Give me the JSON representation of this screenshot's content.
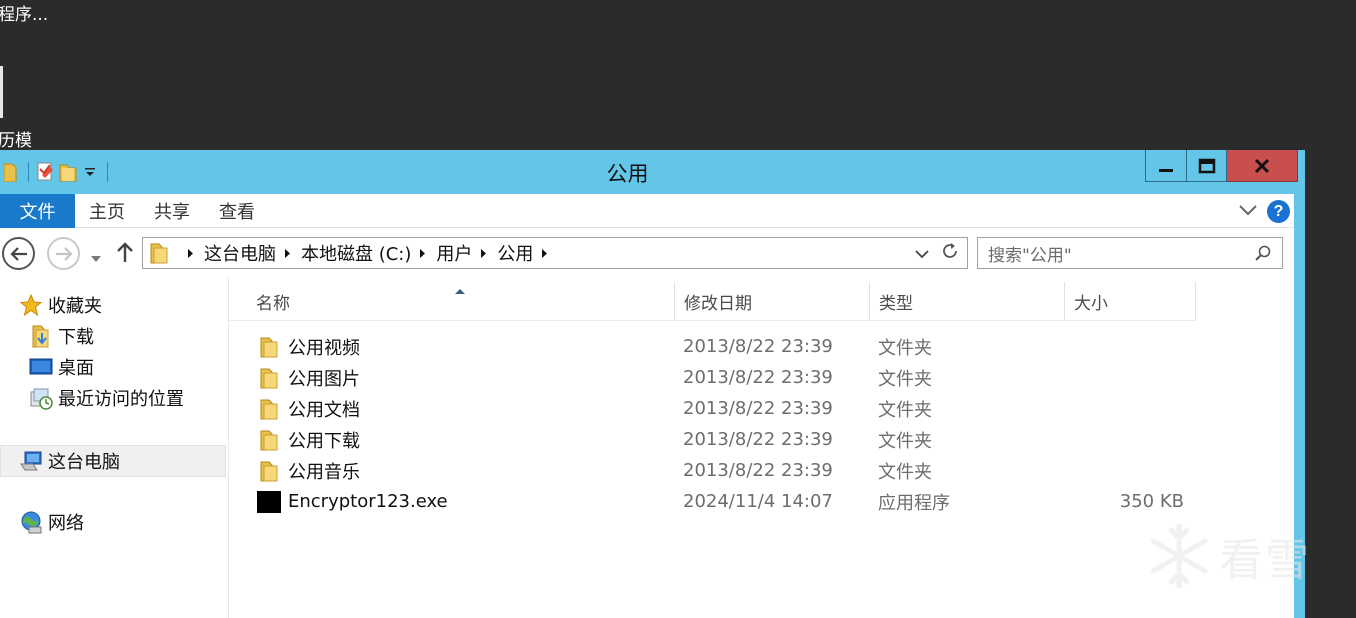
{
  "desktop": {
    "fragment_top": "程序...",
    "fragment_mid": "历模"
  },
  "window": {
    "title": "公用",
    "controls": {
      "minimize": "minimize",
      "maximize": "maximize",
      "close": "close"
    }
  },
  "ribbon": {
    "file_tab": "文件",
    "tabs": [
      "主页",
      "共享",
      "查看"
    ]
  },
  "address": {
    "crumbs": [
      "这台电脑",
      "本地磁盘 (C:)",
      "用户",
      "公用"
    ]
  },
  "search": {
    "placeholder": "搜索\"公用\""
  },
  "sidebar": {
    "favorites": "收藏夹",
    "downloads": "下载",
    "desktop": "桌面",
    "recent": "最近访问的位置",
    "this_pc": "这台电脑",
    "network": "网络"
  },
  "columns": {
    "name": "名称",
    "modified": "修改日期",
    "type": "类型",
    "size": "大小"
  },
  "files": [
    {
      "name": "公用视频",
      "modified": "2013/8/22 23:39",
      "type": "文件夹",
      "size": "",
      "icon": "folder-icon"
    },
    {
      "name": "公用图片",
      "modified": "2013/8/22 23:39",
      "type": "文件夹",
      "size": "",
      "icon": "folder-icon"
    },
    {
      "name": "公用文档",
      "modified": "2013/8/22 23:39",
      "type": "文件夹",
      "size": "",
      "icon": "folder-icon"
    },
    {
      "name": "公用下载",
      "modified": "2013/8/22 23:39",
      "type": "文件夹",
      "size": "",
      "icon": "folder-icon"
    },
    {
      "name": "公用音乐",
      "modified": "2013/8/22 23:39",
      "type": "文件夹",
      "size": "",
      "icon": "folder-icon"
    },
    {
      "name": "Encryptor123.exe",
      "modified": "2024/11/4 14:07",
      "type": "应用程序",
      "size": "350 KB",
      "icon": "exe-icon"
    }
  ],
  "watermark": {
    "text": "看雪"
  },
  "colors": {
    "titlebar": "#63c5e8",
    "file_tab": "#1979ca",
    "close_button": "#c94f4f",
    "desktop": "#2b2b2b"
  }
}
